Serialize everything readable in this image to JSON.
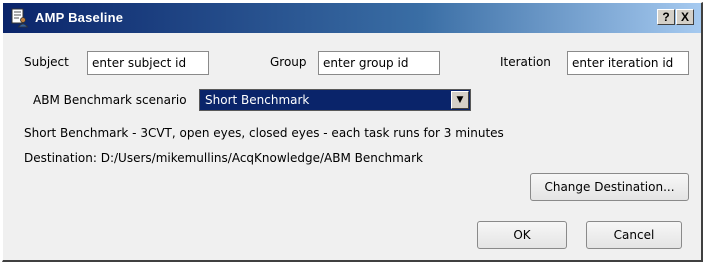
{
  "window": {
    "title": "AMP Baseline",
    "help_button": "?",
    "close_button": "X",
    "app_icon": "document-person-icon"
  },
  "form": {
    "subject_label": "Subject",
    "subject_value": "enter subject id",
    "group_label": "Group",
    "group_value": "enter group id",
    "iteration_label": "Iteration",
    "iteration_value": "enter iteration id",
    "scenario_label": "ABM Benchmark scenario",
    "scenario_selected": "Short Benchmark",
    "description": "Short Benchmark - 3CVT,  open eyes, closed eyes - each task runs for 3 minutes",
    "destination": "Destination: D:/Users/mikemullins/AcqKnowledge/ABM Benchmark"
  },
  "buttons": {
    "change_destination": "Change Destination...",
    "ok": "OK",
    "cancel": "Cancel"
  },
  "colors": {
    "titlebar_start": "#0a246a",
    "titlebar_end": "#a6caf0",
    "selection": "#0a246a",
    "client_bg": "#f0f0f0"
  }
}
